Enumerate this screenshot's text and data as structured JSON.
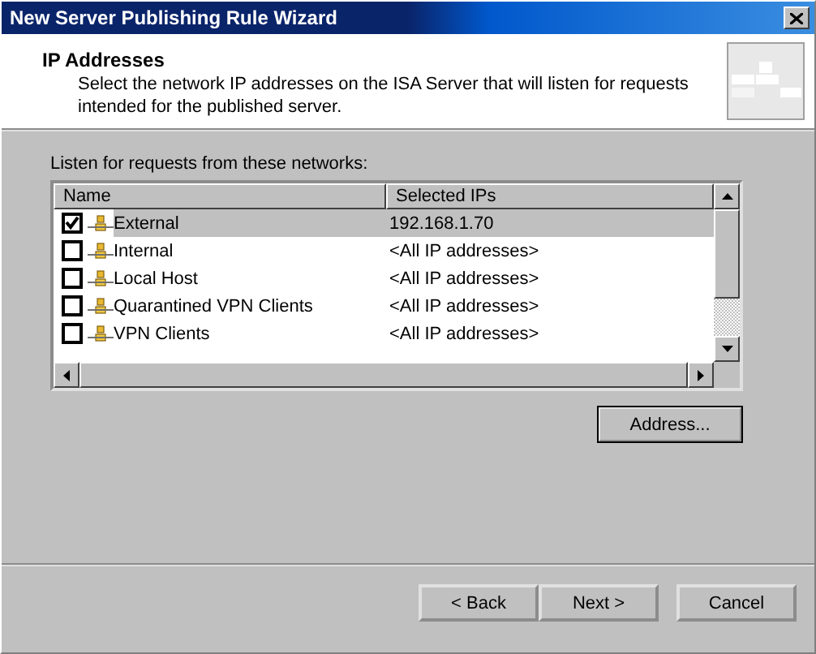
{
  "window": {
    "title": "New Server Publishing Rule Wizard"
  },
  "header": {
    "title": "IP Addresses",
    "description": "Select the network IP addresses on the ISA Server that will listen for requests intended for the published server."
  },
  "list_label": "Listen for requests from these networks:",
  "table": {
    "columns": [
      "Name",
      "Selected IPs"
    ],
    "rows": [
      {
        "name": "External",
        "ips": "192.168.1.70",
        "checked": true,
        "selected": true
      },
      {
        "name": "Internal",
        "ips": "<All IP addresses>",
        "checked": false,
        "selected": false
      },
      {
        "name": "Local Host",
        "ips": "<All IP addresses>",
        "checked": false,
        "selected": false
      },
      {
        "name": "Quarantined VPN Clients",
        "ips": "<All IP addresses>",
        "checked": false,
        "selected": false
      },
      {
        "name": "VPN Clients",
        "ips": "<All IP addresses>",
        "checked": false,
        "selected": false
      }
    ]
  },
  "address_button": "Address...",
  "buttons": [
    "< Back",
    "Next >",
    "Cancel"
  ]
}
